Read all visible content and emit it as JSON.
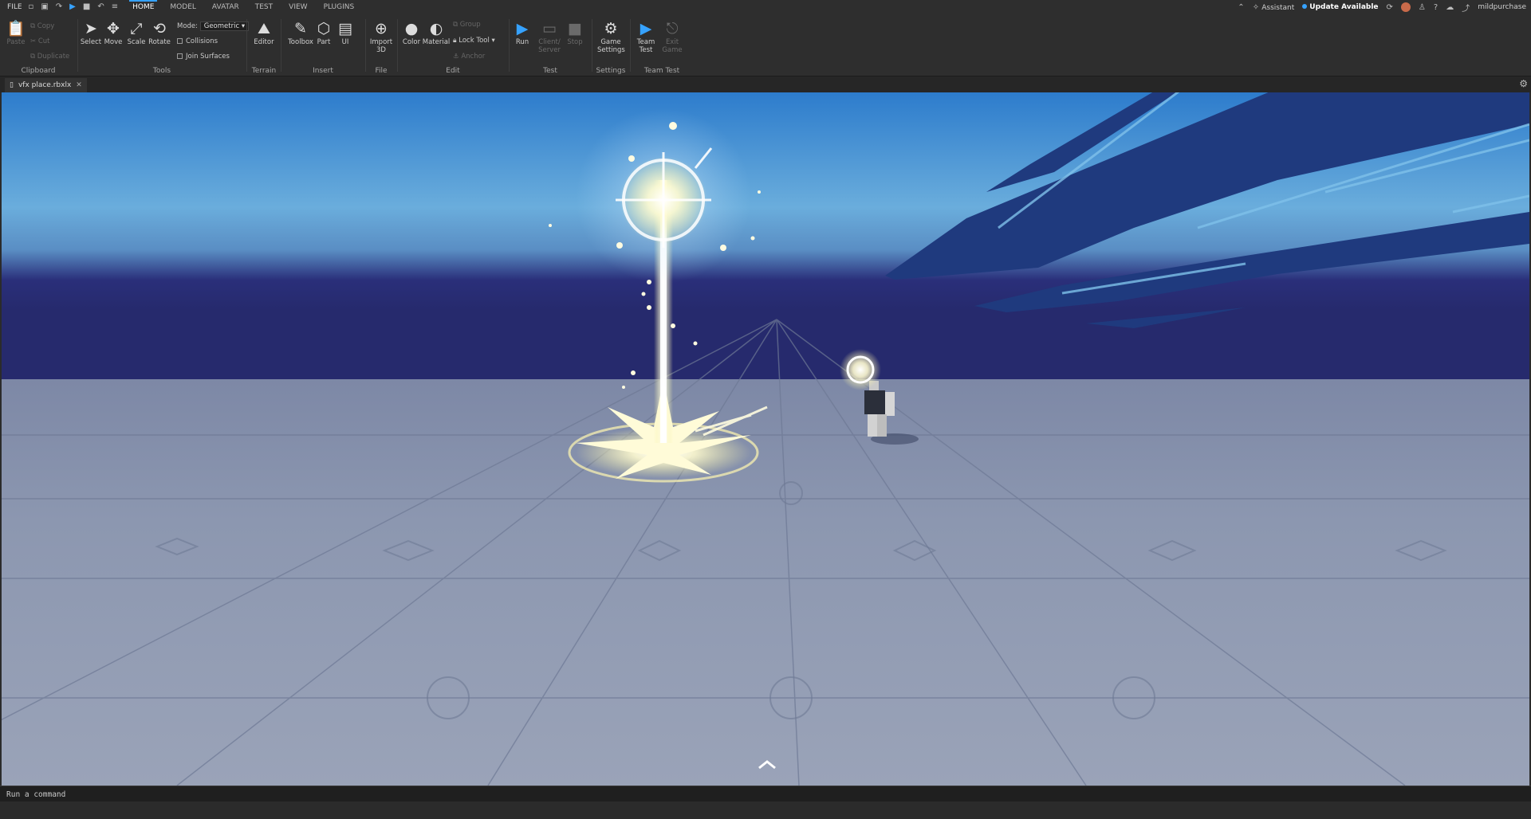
{
  "menubar": {
    "file": "FILE",
    "tabs": [
      "HOME",
      "MODEL",
      "AVATAR",
      "TEST",
      "VIEW",
      "PLUGINS"
    ],
    "active_tab": "HOME"
  },
  "topright": {
    "assistant": "Assistant",
    "update": "Update Available",
    "username": "mildpurchase"
  },
  "ribbon": {
    "clipboard": {
      "paste": "Paste",
      "copy": "Copy",
      "cut": "Cut",
      "duplicate": "Duplicate",
      "label": "Clipboard"
    },
    "tools": {
      "select": "Select",
      "move": "Move",
      "scale": "Scale",
      "rotate": "Rotate",
      "mode_label": "Mode:",
      "mode_value": "Geometric",
      "collisions": "Collisions",
      "join_surfaces": "Join Surfaces",
      "label": "Tools"
    },
    "terrain": {
      "editor": "Editor",
      "label": "Terrain"
    },
    "insert": {
      "toolbox": "Toolbox",
      "part": "Part",
      "ui": "UI",
      "label": "Insert"
    },
    "file": {
      "import3d_1": "Import",
      "import3d_2": "3D",
      "label": "File"
    },
    "edit": {
      "color": "Color",
      "material": "Material",
      "group": "Group",
      "lock_tool": "Lock Tool",
      "anchor": "Anchor",
      "label": "Edit"
    },
    "test": {
      "run": "Run",
      "client_server_1": "Client/",
      "client_server_2": "Server",
      "stop": "Stop",
      "label": "Test"
    },
    "settings": {
      "game_settings_1": "Game",
      "game_settings_2": "Settings",
      "label": "Settings"
    },
    "team_test": {
      "team_test_1": "Team",
      "team_test_2": "Test",
      "exit_game_1": "Exit",
      "exit_game_2": "Game",
      "label": "Team Test"
    }
  },
  "document": {
    "tab_title": "vfx place.rbxlx"
  },
  "command": {
    "placeholder": "Run a command"
  },
  "colors": {
    "accent": "#36a2ff",
    "sky_top": "#2f7fd0",
    "horizon": "#232a6e",
    "ground": "#8e99b0",
    "vfx_glow": "#fffbd0"
  }
}
